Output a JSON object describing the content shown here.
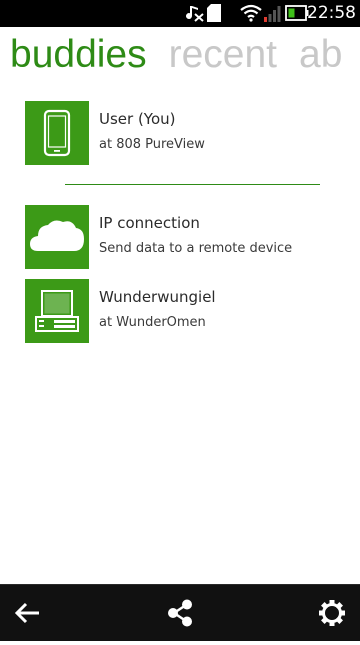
{
  "status_bar": {
    "time": "22:58",
    "icons": [
      "music-note-off-icon",
      "sd-card-icon",
      "wifi-icon",
      "signal-icon",
      "battery-icon"
    ]
  },
  "pivot": {
    "tabs": [
      {
        "label": "buddies",
        "active": true
      },
      {
        "label": "recent",
        "active": false
      },
      {
        "label": "ab",
        "active": false
      }
    ]
  },
  "buddies": [
    {
      "icon": "phone-icon",
      "title": "User (You)",
      "subtitle": "at 808 PureView"
    },
    {
      "icon": "cloud-icon",
      "title": "IP connection",
      "subtitle": "Send data to a remote device"
    },
    {
      "icon": "computer-icon",
      "title": "Wunderwungiel",
      "subtitle": "at WunderOmen"
    }
  ],
  "toolbar": {
    "buttons": [
      "back-arrow-icon",
      "share-icon",
      "settings-gear-icon"
    ]
  },
  "colors": {
    "accent": "#3c9a17",
    "active_tab": "#2e8b16",
    "inactive_tab": "#c8c8c8",
    "toolbar_bg": "#111111"
  }
}
